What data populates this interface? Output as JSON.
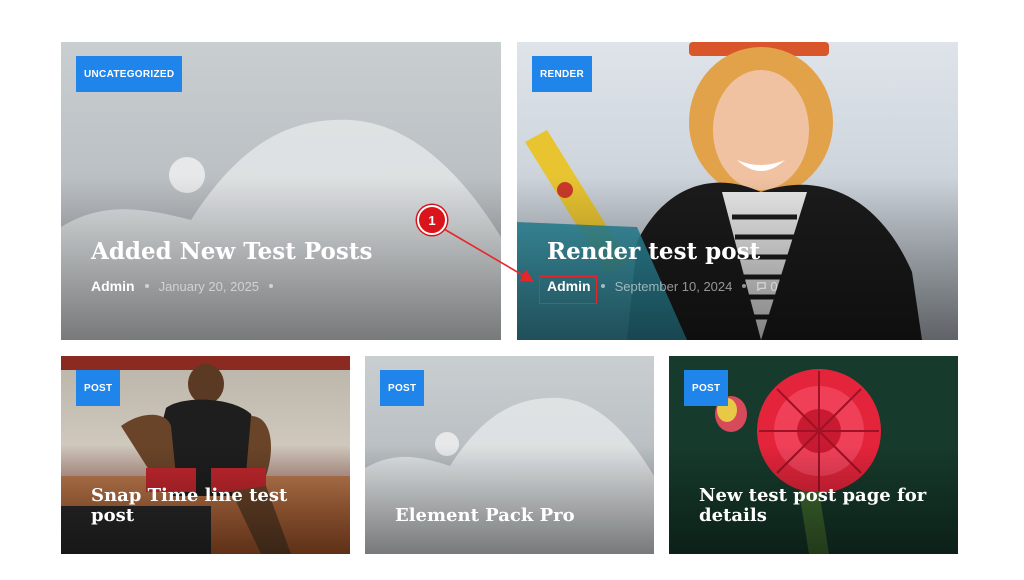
{
  "cards": [
    {
      "badge": "UNCATEGORIZED",
      "title": "Added New Test Posts",
      "author": "Admin",
      "date": "January 20, 2025"
    },
    {
      "badge": "RENDER",
      "title": "Render test post",
      "author": "Admin",
      "date": "September 10, 2024",
      "comments": "0"
    },
    {
      "badge": "POST",
      "title_lines": [
        "Snap Time line test",
        "post"
      ]
    },
    {
      "badge": "POST",
      "title": "Element Pack Pro"
    },
    {
      "badge": "POST",
      "title_lines": [
        "New test post page for",
        "details"
      ]
    }
  ],
  "annotation": {
    "number": "1"
  },
  "colors": {
    "badge": "#1f85ea",
    "annotation": "#d9141a"
  }
}
